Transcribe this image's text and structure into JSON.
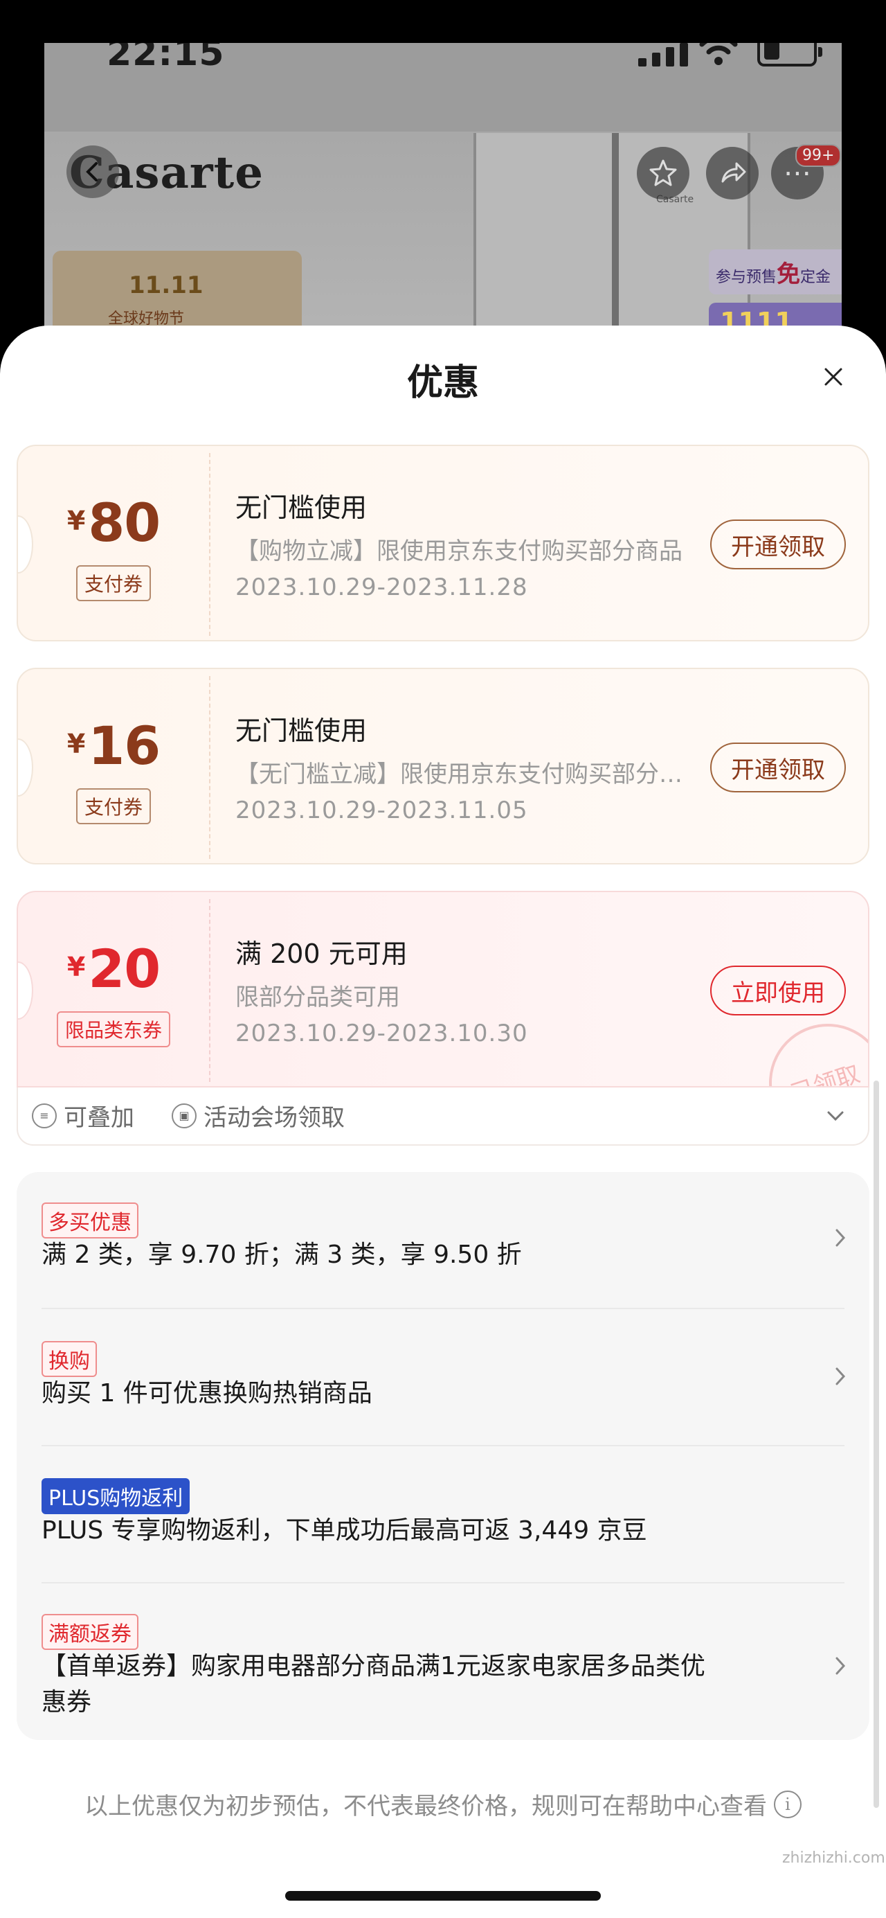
{
  "status_bar": {
    "time": "22:15"
  },
  "background_page": {
    "brand": "Casarte",
    "fridge_logo": "Casarte",
    "notification_count": "99+",
    "promo_left_title": "11.11",
    "promo_left_sub": "全球好物节",
    "promo_right_line1": "参与预售",
    "promo_right_free": "免",
    "promo_right_line1b": "定金",
    "promo_right_line2": "1111"
  },
  "sheet": {
    "title": "优惠"
  },
  "coupons": [
    {
      "currency": "¥",
      "amount": "80",
      "type": "支付券",
      "title": "无门槛使用",
      "desc": "【购物立减】限使用京东支付购买部分商品",
      "date": "2023.10.29-2023.11.28",
      "button": "开通领取"
    },
    {
      "currency": "¥",
      "amount": "16",
      "type": "支付券",
      "title": "无门槛使用",
      "desc": "【无门槛立减】限使用京东支付购买部分商品",
      "date": "2023.10.29-2023.11.05",
      "button": "开通领取"
    },
    {
      "currency": "¥",
      "amount": "20",
      "type": "限品类东券",
      "title": "满 200 元可用",
      "desc": "限部分品类可用",
      "date": "2023.10.29-2023.10.30",
      "button": "立即使用",
      "stamp": "已领取"
    }
  ],
  "coupon_tags": {
    "stackable": "可叠加",
    "venue": "活动会场领取"
  },
  "offers": [
    {
      "tag": "多买优惠",
      "text": "满 2 类，享 9.70 折；满 3 类，享 9.50 折"
    },
    {
      "tag": "换购",
      "text": "购买 1 件可优惠换购热销商品"
    },
    {
      "tag": "PLUS购物返利",
      "text": "PLUS 专享购物返利，下单成功后最高可返 3,449 京豆"
    },
    {
      "tag": "满额返券",
      "text": "【首单返券】购家用电器部分商品满1元返家电家居多品类优惠券"
    }
  ],
  "footer": {
    "note": "以上优惠仅为初步预估，不代表最终价格，规则可在帮助中心查看"
  },
  "watermark": "zhizhizhi.com",
  "colors": {
    "brand_brown": "#8b3a1b",
    "jd_red": "#e0282e",
    "plus_blue": "#2c52c9"
  }
}
